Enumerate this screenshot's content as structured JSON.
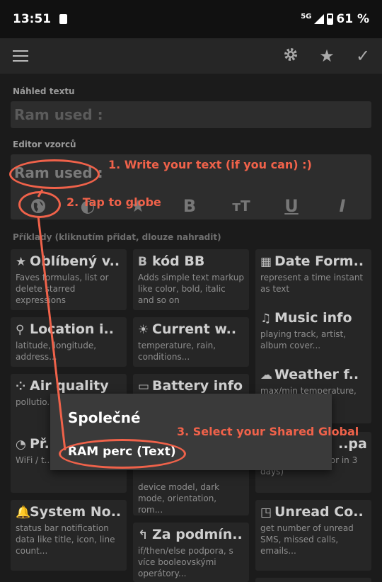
{
  "status": {
    "time": "13:51",
    "network": "5G",
    "battery": "61 %"
  },
  "toolbar": {
    "menu_icon": "hamburger-icon",
    "settings_icon": "gear-icon",
    "favorite_icon": "star-icon",
    "confirm_icon": "check-icon"
  },
  "preview": {
    "label": "Náhled textu",
    "value": "Ram used :"
  },
  "editor": {
    "label": "Editor vzorců",
    "value": "Ram used :",
    "format_icons": [
      "globe-icon",
      "palette-icon",
      "star-icon",
      "bold-icon",
      "text-size-icon",
      "underline-icon",
      "italic-icon"
    ],
    "glyphs": [
      "B",
      "тT",
      "U",
      "I"
    ]
  },
  "examples": {
    "label": "Příklady (kliknutím přidat, dlouze nahradit)",
    "cards": [
      {
        "icon": "★",
        "title": "Oblíbený v..",
        "desc": "Faves formulas, list or delete starred expressions"
      },
      {
        "icon": "B",
        "title": "kód BB",
        "desc": "Adds simple text markup like color, bold, italic and so on"
      },
      {
        "icon": "▦",
        "title": "Date Form..",
        "desc": "represent a time instant as text"
      },
      {
        "icon": "⚲",
        "title": "Location i..",
        "desc": "latitude, longitude, address..."
      },
      {
        "icon": "☀",
        "title": "Current w..",
        "desc": "temperature, rain, conditions..."
      },
      {
        "icon": "♫",
        "title": "Music info",
        "desc": "playing track, artist, album cover..."
      },
      {
        "icon": "⁘",
        "title": "Air quality",
        "desc": "pollutio... pm10..."
      },
      {
        "icon": "▭",
        "title": "Battery info",
        "desc": ""
      },
      {
        "icon": "☁",
        "title": "Weather f..",
        "desc": "max/min temperature, ..."
      },
      {
        "icon": "◔",
        "title": "Př..",
        "desc": "WiFi / t... jméno ... sítě..."
      },
      {
        "icon": "",
        "title": "",
        "desc": "device model, dark mode, orientation, rom..."
      },
      {
        "icon": "",
        "title": "..pan",
        "desc": "... time ...rs ago or in 3 days)"
      },
      {
        "icon": "🔔",
        "title": "System No..",
        "desc": "status bar notification data like title, icon, line count..."
      },
      {
        "icon": "↰",
        "title": "Za podmín..",
        "desc": "if/then/else podpora, s více booleovskými operátory..."
      },
      {
        "icon": "◳",
        "title": "Unread Co..",
        "desc": "get number of unread SMS, missed calls, emails..."
      }
    ]
  },
  "dialog": {
    "title": "Společné",
    "item": "RAM perc (Text)"
  },
  "annotations": {
    "step1": "1. Write your text (if you can) :)",
    "step2": "2. Tap to globe",
    "step3": "3. Select your Shared Global",
    "color": "#f0624a"
  }
}
